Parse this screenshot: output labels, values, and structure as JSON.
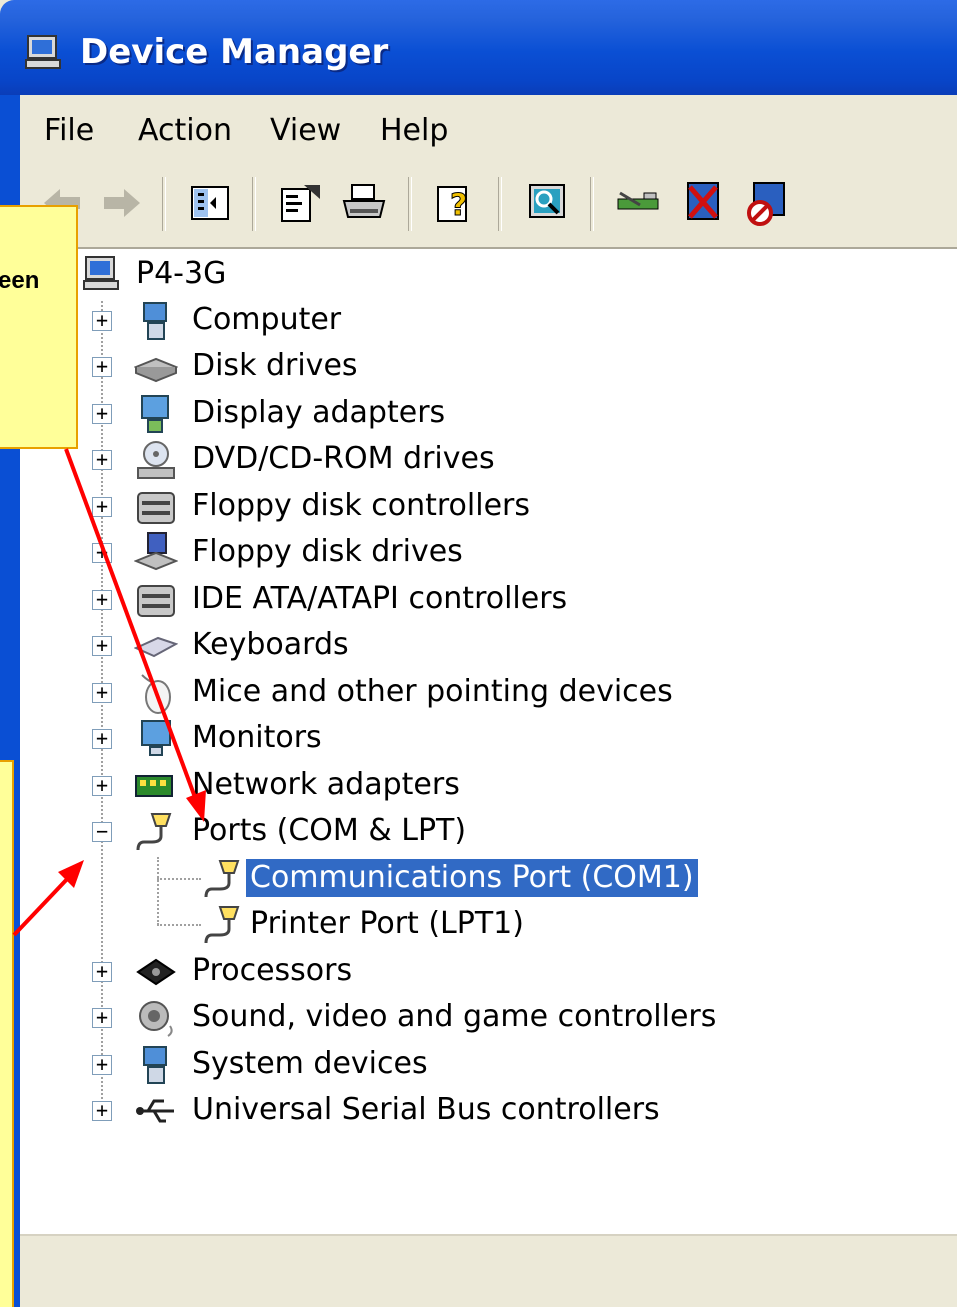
{
  "window": {
    "title": "Device Manager"
  },
  "menu": [
    "File",
    "Action",
    "View",
    "Help"
  ],
  "toolbar": {
    "buttons": [
      "back-icon",
      "forward-icon",
      "show-hide-tree-icon",
      "properties-icon",
      "print-icon",
      "help-icon",
      "scan-hardware-icon",
      "update-driver-icon",
      "uninstall-icon",
      "disable-icon"
    ]
  },
  "tree": {
    "root": "P4-3G",
    "categories": [
      "Computer",
      "Disk drives",
      "Display adapters",
      "DVD/CD-ROM drives",
      "Floppy disk controllers",
      "Floppy disk drives",
      "IDE ATA/ATAPI controllers",
      "Keyboards",
      "Mice and other pointing devices",
      "Monitors",
      "Network adapters",
      "Ports (COM & LPT)",
      "Processors",
      "Sound, video and game controllers",
      "System devices",
      "Universal Serial Bus controllers"
    ],
    "ports_children": [
      "Communications Port (COM1)",
      "Printer Port (LPT1)"
    ],
    "selected": "Communications Port (COM1)"
  },
  "callouts": {
    "top_fragment": "een"
  },
  "colors": {
    "titlebar": "#0a4fd4",
    "selection": "#316ac5",
    "callout_fill": "#ffff99",
    "arrow": "#ff0000"
  }
}
